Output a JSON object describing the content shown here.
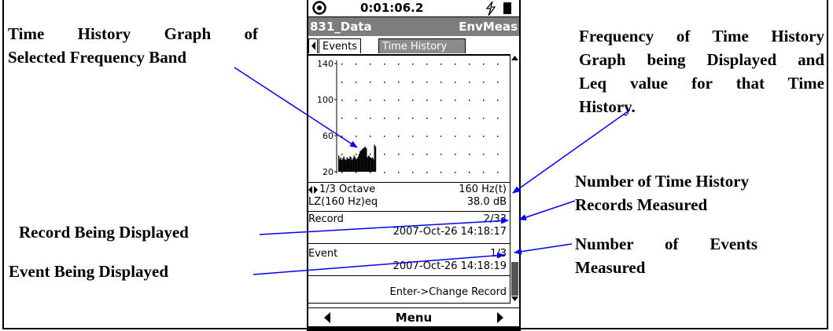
{
  "annotations": {
    "time_history_graph": [
      "Time History Graph of",
      "Selected Frequency Band"
    ],
    "frequency_info": [
      "Frequency of Time History",
      "Graph being Displayed and",
      "Leq value for that Time",
      "History."
    ],
    "num_th_records": [
      "Number of Time History",
      "Records Measured"
    ],
    "record_displayed": "Record Being Displayed",
    "num_events": [
      "Number of Events",
      "Measured"
    ],
    "event_displayed": "Event Being Displayed"
  },
  "device": {
    "status": {
      "time": "0:01:06.2"
    },
    "title": {
      "left": "831_Data",
      "right": "EnvMeas"
    },
    "tabs": [
      {
        "label": "Events",
        "active": true
      },
      {
        "label": "Time History",
        "active": false
      }
    ],
    "graph": {
      "y_ticks": [
        "140",
        "100",
        "60",
        "20"
      ],
      "y_range": [
        20,
        140
      ],
      "samples": [
        38,
        34,
        36,
        33,
        35,
        37,
        34,
        33,
        36,
        35,
        34,
        37,
        36,
        33,
        35,
        38,
        36,
        34,
        35,
        37,
        40,
        43,
        44,
        45,
        46,
        47,
        48,
        46,
        36,
        38,
        37,
        36,
        35,
        36,
        34,
        50,
        48
      ]
    },
    "band_row": {
      "left": "1/3 Octave",
      "right": "160 Hz(t)"
    },
    "leq_row": {
      "left": "LZ(160 Hz)eq",
      "right": "38.0 dB"
    },
    "record": {
      "label": "Record",
      "count": "2/33",
      "timestamp": "2007-Oct-26 14:18:17"
    },
    "event": {
      "label": "Event",
      "count": "1/3",
      "timestamp": "2007-Oct-26 14:18:19"
    },
    "hint": "Enter->Change Record",
    "softkey_center": "Menu"
  },
  "colors": {
    "arrow": "#0000ff",
    "titlebar": "#7d7d7d",
    "tab_inactive": "#8c8c8c"
  }
}
